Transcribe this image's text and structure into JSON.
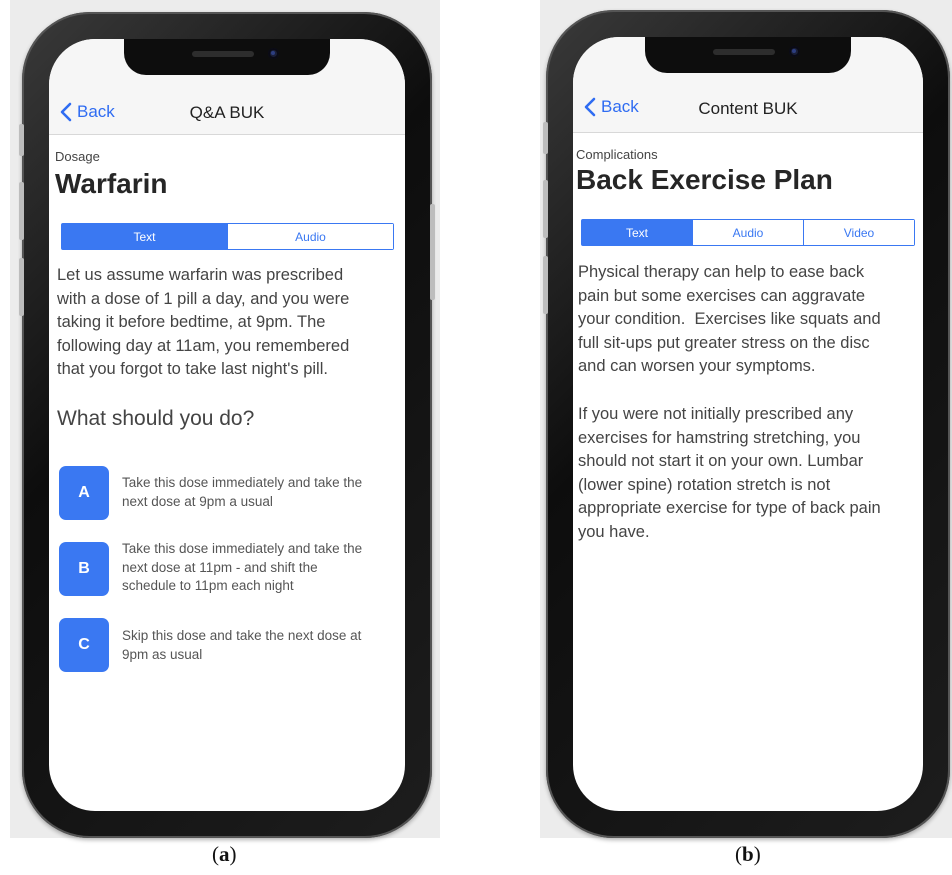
{
  "panel_a": {
    "nav": {
      "back_label": "Back",
      "title": "Q&A BUK"
    },
    "category": "Dosage",
    "title": "Warfarin",
    "tabs": [
      {
        "label": "Text",
        "active": true
      },
      {
        "label": "Audio",
        "active": false
      }
    ],
    "body_lines": [
      "Let us assume warfarin was prescribed",
      "with a dose of 1 pill a day, and you were",
      "taking it before bedtime, at 9pm. The",
      "following day at 11am, you remembered",
      "that you forgot to take last night's pill."
    ],
    "question": "What should you do?",
    "options": [
      {
        "letter": "A",
        "lines": [
          "Take this dose immediately and take the",
          "next dose at 9pm a usual"
        ]
      },
      {
        "letter": "B",
        "lines": [
          "Take this dose immediately and take the",
          "next dose at 11pm - and shift the",
          "schedule to 11pm each night"
        ]
      },
      {
        "letter": "C",
        "lines": [
          "Skip this dose and take the next dose at",
          "9pm as usual"
        ]
      }
    ],
    "caption": {
      "open": "(",
      "letter": "a",
      "close": ")"
    }
  },
  "panel_b": {
    "nav": {
      "back_label": "Back",
      "title": "Content BUK"
    },
    "category": "Complications",
    "title": "Back Exercise Plan",
    "tabs": [
      {
        "label": "Text",
        "active": true
      },
      {
        "label": "Audio",
        "active": false
      },
      {
        "label": "Video",
        "active": false
      }
    ],
    "paragraph1_lines": [
      "Physical therapy can help to ease back",
      "pain but some exercises can aggravate",
      "your condition.  Exercises like squats and",
      "full sit-ups put greater stress on the disc",
      "and can worsen your symptoms."
    ],
    "paragraph2_lines": [
      "If you were not initially prescribed any",
      "exercises for hamstring stretching, you",
      "should not start it on your own. Lumbar",
      "(lower spine) rotation stretch is not",
      "appropriate exercise for type of back pain",
      "you have."
    ],
    "caption": {
      "open": "(",
      "letter": "b",
      "close": ")"
    }
  },
  "icons": {
    "back": "chevron-left-icon"
  },
  "colors": {
    "accent": "#3a78f2",
    "back_link": "#2f6cf2",
    "nav_bg": "#f6f6f6",
    "frame_bg": "#ececec"
  }
}
